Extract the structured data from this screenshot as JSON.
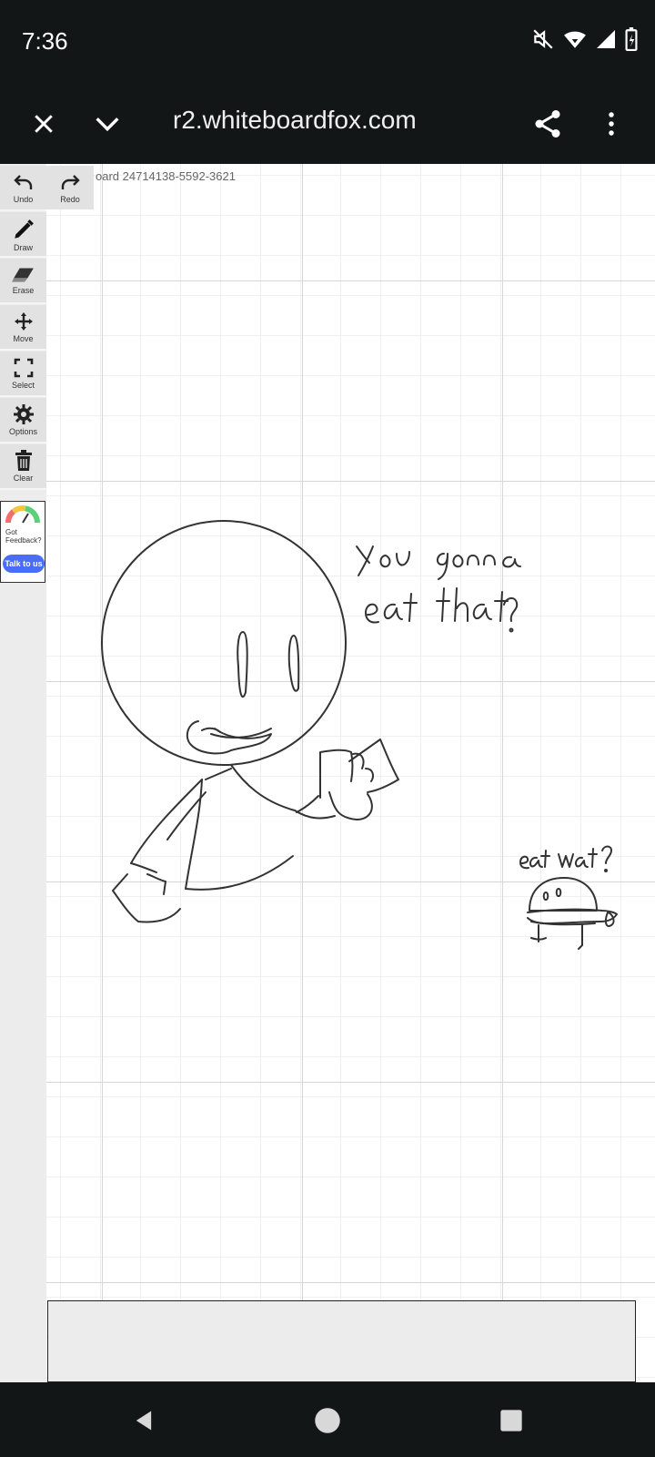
{
  "status_bar": {
    "time": "7:36",
    "icons": [
      "mute-icon",
      "wifi-icon",
      "signal-icon",
      "battery-icon"
    ]
  },
  "browser": {
    "url": "r2.whiteboardfox.com",
    "icons": [
      "close-icon",
      "chevron-down-icon",
      "share-icon",
      "more-icon"
    ]
  },
  "whiteboard": {
    "board_id": "oard 24714138-5592-3621",
    "tools": [
      {
        "label": "Undo",
        "icon": "undo-icon"
      },
      {
        "label": "Redo",
        "icon": "redo-icon"
      },
      {
        "label": "Draw",
        "icon": "pencil-icon"
      },
      {
        "label": "Erase",
        "icon": "eraser-icon"
      },
      {
        "label": "Move",
        "icon": "move-icon"
      },
      {
        "label": "Select",
        "icon": "select-icon"
      },
      {
        "label": "Options",
        "icon": "gear-icon"
      },
      {
        "label": "Clear",
        "icon": "trash-icon"
      }
    ],
    "feedback": {
      "text": "Got Feedback?",
      "button": "Talk to us"
    },
    "drawing_text": {
      "line1": "you gonna",
      "line2": "eat that?",
      "small": "eat wat?"
    }
  },
  "colors": {
    "system_bar": "#121616",
    "grid_minor": "#ebebeb",
    "grid_major": "#d6d6d6",
    "feedback_button": "#4a6cf7"
  },
  "navigation": {
    "icons": [
      "back-icon",
      "home-icon",
      "recents-icon"
    ]
  }
}
